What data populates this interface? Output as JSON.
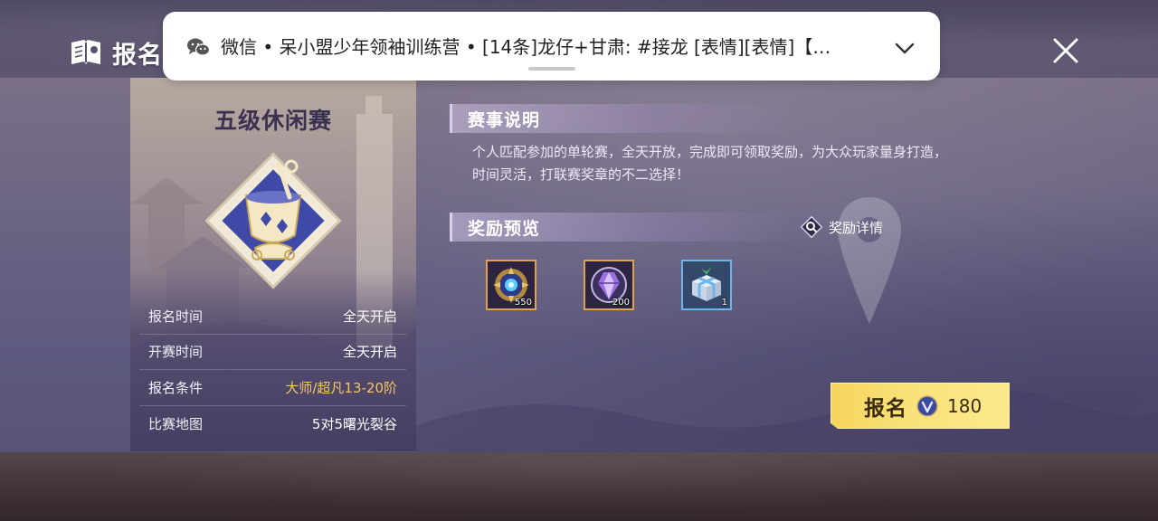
{
  "header": {
    "title": "报名"
  },
  "notification": {
    "text": "微信 • 呆小盟少年领袖训练营 • [14条]龙仔+甘肃: #接龙 [表情][表情]【…",
    "app_icon": "wechat-icon",
    "expand_icon": "chevron-down-icon"
  },
  "match_card": {
    "name": "五级休闲赛",
    "emblem_icon": "trophy-cup-emblem-icon",
    "info": [
      {
        "label": "报名时间",
        "value": "全天开启"
      },
      {
        "label": "开赛时间",
        "value": "全天开启"
      },
      {
        "label": "报名条件",
        "value": "大师/超凡13-20阶"
      },
      {
        "label": "比赛地图",
        "value": "5对5曙光裂谷"
      }
    ]
  },
  "description": {
    "title": "赛事说明",
    "text_line1": "个人匹配参加的单轮赛，全天开放，完成即可领取奖励，为大众玩家量身打造，",
    "text_line2": "时间灵活，打联赛奖章的不二选择！"
  },
  "rewards": {
    "title": "奖励预览",
    "detail_label": "奖励详情",
    "items": [
      {
        "icon": "blue-medal-icon",
        "count": "550"
      },
      {
        "icon": "purple-crystal-icon",
        "count": "200"
      },
      {
        "icon": "gift-box-icon",
        "count": "1"
      }
    ]
  },
  "signup": {
    "label": "报名",
    "cost": "180",
    "currency_icon": "coin-icon"
  },
  "colors": {
    "condition_highlight": "#f5c567",
    "button_gold": "#f9e27b",
    "reward_border_gold": "#e0a24c",
    "reward_border_blue": "#6fb6e8"
  }
}
